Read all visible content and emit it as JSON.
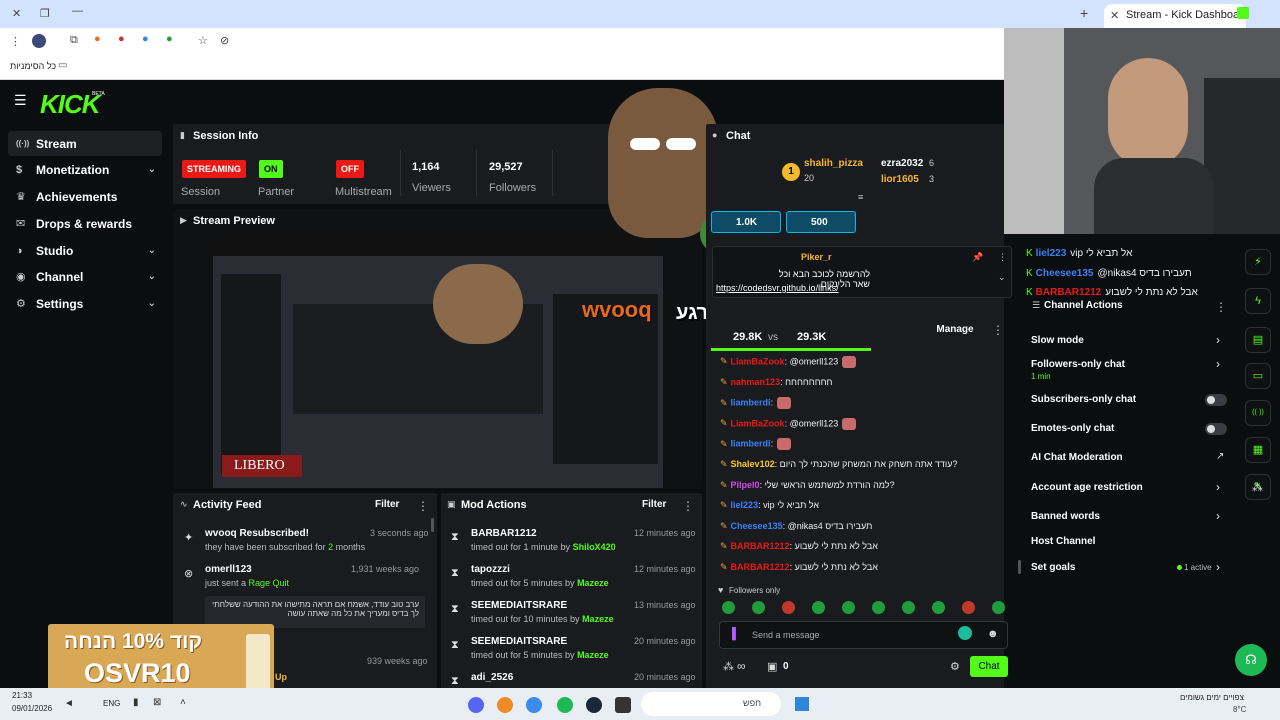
{
  "browser": {
    "tab_title": "Stream - Kick Dashboard",
    "bookmarks_label": "כל הסימניות"
  },
  "app": {
    "logo": "KICK",
    "logo_beta": "BETA",
    "nav": [
      {
        "label": "Stream",
        "icon": "stream-icon"
      },
      {
        "label": "Monetization",
        "icon": "dollar-icon"
      },
      {
        "label": "Achievements",
        "icon": "trophy-icon"
      },
      {
        "label": "Drops & rewards",
        "icon": "gift-icon"
      },
      {
        "label": "Studio",
        "icon": "studio-icon"
      },
      {
        "label": "Channel",
        "icon": "channel-icon"
      },
      {
        "label": "Settings",
        "icon": "gear-icon"
      }
    ]
  },
  "session": {
    "title": "Session Info",
    "badges": [
      {
        "label": "STREAMING",
        "caption": "Session",
        "color": "#e91916"
      },
      {
        "label": "ON",
        "caption": "Partner",
        "color": "#53fc18"
      },
      {
        "label": "OFF",
        "caption": "Multistream",
        "color": "#e91916"
      }
    ],
    "stats": [
      {
        "value": "1,164",
        "label": "Viewers"
      },
      {
        "value": "29,527",
        "label": "Followers"
      }
    ]
  },
  "preview": {
    "title": "Stream Preview",
    "overlay_name": "wvooq",
    "overlay_text": "קח קצת תרגע"
  },
  "activity": {
    "title": "Activity Feed",
    "filter": "Filter",
    "items": [
      {
        "name": "wvooq Resubscribed!",
        "sub_a": "they have been subscribed for ",
        "sub_b": "2",
        "sub_c": " months",
        "time": "3 seconds ago"
      },
      {
        "name": "omerll123",
        "sub_a": "just sent a ",
        "sub_b": "Rage Quit",
        "sub_c": "",
        "time": "1,931 weeks ago",
        "quote": "ערב טוב עודד, אשמח אם תראה מתישהו את ההודעה ששלחתי לך בדיס ומעריך את כל מה שאתה עושה"
      },
      {
        "name": "",
        "sub_a": "",
        "sub_b": "Up",
        "sub_c": "",
        "time": "939 weeks ago"
      }
    ],
    "promo_line1": "קוד 10% הנחה",
    "promo_line2": "OSVR10"
  },
  "mod": {
    "title": "Mod Actions",
    "filter": "Filter",
    "items": [
      {
        "name": "BARBAR1212",
        "detail": "timed out for 1 minute by ",
        "by": "ShiloX420",
        "time": "12 minutes ago"
      },
      {
        "name": "tapozzzi",
        "detail": "timed out for 5 minutes by ",
        "by": "Mazeze",
        "time": "12 minutes ago"
      },
      {
        "name": "SEEMEDIAITSRARE",
        "detail": "timed out for 10 minutes by ",
        "by": "Mazeze",
        "time": "13 minutes ago"
      },
      {
        "name": "SEEMEDIAITSRARE",
        "detail": "timed out for 5 minutes by ",
        "by": "Mazeze",
        "time": "20 minutes ago"
      },
      {
        "name": "adi_2526",
        "detail": "",
        "by": "",
        "time": "20 minutes ago"
      }
    ]
  },
  "chat": {
    "title": "Chat",
    "top": [
      {
        "rank": "1",
        "name": "shalih_pizza",
        "count": "20"
      },
      {
        "name": "ezra2032",
        "count": "6"
      },
      {
        "name": "lior1605",
        "count": "3"
      }
    ],
    "bars": [
      "1.0K",
      "500"
    ],
    "pinned_user": "Piker_r",
    "pinned_text": "להרשמה לכוכב הבא וכל שאר הלינקים",
    "pinned_link": "https://codedsvr.github.io/links/",
    "vs": {
      "left": "29.8K",
      "mid": "vs",
      "right": "29.3K"
    },
    "manage": "Manage",
    "lines": [
      {
        "user": "LiamBaZook",
        "color": "#e91916",
        "text": ": @omerll123"
      },
      {
        "user": "nahman123",
        "color": "#e91916",
        "text": ": חחחחחחחח"
      },
      {
        "user": "liamberdi",
        "color": "#3b82f6",
        "text": ":"
      },
      {
        "user": "LiamBaZook",
        "color": "#e91916",
        "text": ": @omerll123"
      },
      {
        "user": "liamberdi",
        "color": "#3b82f6",
        "text": ":"
      },
      {
        "user": "Shalev102",
        "color": "#facc15",
        "text": ": עודד אתה תשחק את המשחק שהכנתי לך היום?"
      },
      {
        "user": "Pilpel0",
        "color": "#d946ef",
        "text": ": למה הורדת למשתמש הראשי שלי?"
      },
      {
        "user": "liel223",
        "color": "#3b82f6",
        "text": ": vip אל תביא לי"
      },
      {
        "user": "Cheesee135",
        "color": "#3b82f6",
        "text": ": @nikas4 תעבירו בדיס"
      },
      {
        "user": "BARBAR1212",
        "color": "#e91916",
        "text": ": אבל לא נתת לי לשבוע"
      },
      {
        "user": "BARBAR1212",
        "color": "#e91916",
        "text": ": אבל לא נתת לי לשבוע"
      }
    ],
    "followers_only": "Followers only",
    "placeholder": "Send a message",
    "points": "0",
    "send": "Chat"
  },
  "channel_actions": {
    "title": "Channel Actions",
    "items": [
      {
        "label": "Slow mode",
        "type": "chevron"
      },
      {
        "label": "Followers-only chat",
        "sub": "1 min",
        "type": "chevron"
      },
      {
        "label": "Subscribers-only chat",
        "type": "toggle"
      },
      {
        "label": "Emotes-only chat",
        "type": "toggle"
      },
      {
        "label": "AI Chat Moderation",
        "type": "external"
      },
      {
        "label": "Account age restriction",
        "type": "chevron"
      },
      {
        "label": "Banned words",
        "type": "chevron"
      },
      {
        "label": "Host Channel",
        "type": "none"
      },
      {
        "label": "Set goals",
        "extra": "1 active",
        "type": "chevron"
      }
    ],
    "side_lines": [
      {
        "user": "liel223",
        "text": "vip אל תביא לי"
      },
      {
        "user": "Cheesee135",
        "text": "@nikas4 תעבירו בדיס"
      },
      {
        "user": "BARBAR1212",
        "text": "אבל לא נתת לי לשבוע"
      }
    ]
  },
  "taskbar": {
    "time": "21:33",
    "date": "09/01/2026",
    "lang": "ENG",
    "search": "חפש",
    "weather": "צפויים ימים גשומים",
    "temp": "8°C"
  },
  "colors": {
    "accent": "#53fc18",
    "panel": "#191b1f",
    "bg": "#0b0e0f"
  }
}
